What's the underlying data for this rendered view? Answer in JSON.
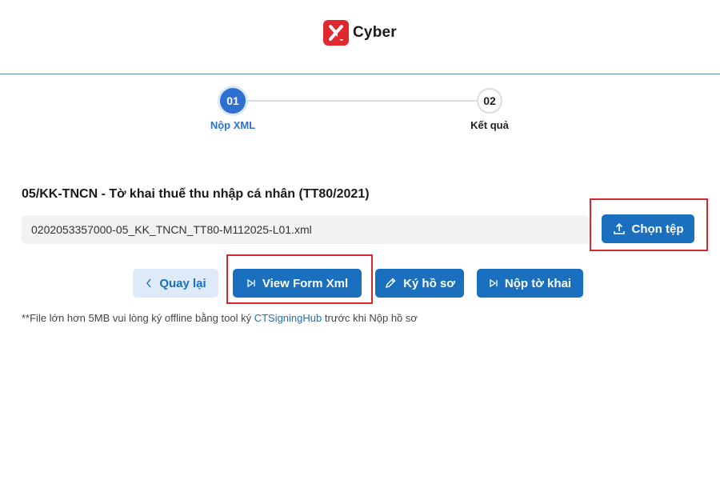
{
  "brand": {
    "name": "Cyber",
    "logo_color": "#e0282e"
  },
  "stepper": {
    "steps": [
      {
        "number": "01",
        "label": "Nộp XML",
        "active": true
      },
      {
        "number": "02",
        "label": "Kết quả",
        "active": false
      }
    ]
  },
  "form": {
    "title": "05/KK-TNCN - Tờ khai thuế thu nhập cá nhân (TT80/2021)",
    "file_name": "0202053357000-05_KK_TNCN_TT80-M112025-L01.xml",
    "choose_file_label": "Chọn tệp"
  },
  "actions": {
    "back_label": "Quay lại",
    "view_xml_label": "View Form Xml",
    "sign_label": "Ký hồ sơ",
    "submit_label": "Nộp tờ khai"
  },
  "note": {
    "prefix": "**File lớn hơn 5MB vui lòng ký offline bằng tool ký ",
    "link_text": "CTSigningHub",
    "suffix": " trước khi Nộp hồ sơ"
  },
  "colors": {
    "primary": "#1a6fbf",
    "step_active": "#2f6fd0",
    "highlight": "#d9272e"
  }
}
